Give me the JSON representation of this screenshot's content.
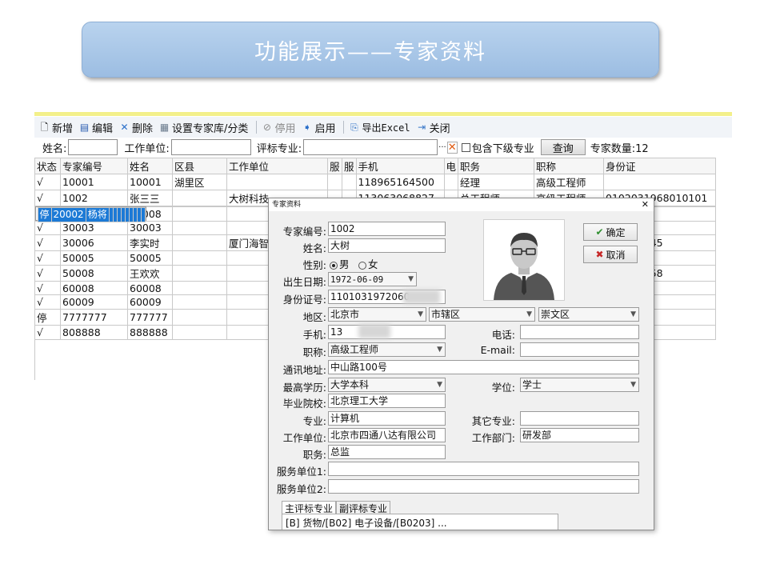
{
  "banner": {
    "title": "功能展示——专家资料"
  },
  "toolbar": {
    "new": "新增",
    "edit": "编辑",
    "delete": "删除",
    "settings": "设置专家库/分类",
    "disable": "停用",
    "enable": "启用",
    "export": "导出Excel",
    "close": "关闭"
  },
  "search": {
    "name_label": "姓名:",
    "org_label": "工作单位:",
    "major_label": "评标专业:",
    "include_sub": "包含下级专业",
    "query": "查询",
    "count": "专家数量:12"
  },
  "grid": {
    "headers": [
      "状态",
      "专家编号",
      "姓名",
      "区县",
      "工作单位",
      "服",
      "服",
      "手机",
      "电",
      "职务",
      "职称",
      "身份证"
    ],
    "rows": [
      [
        "√",
        "10001",
        "10001",
        "湖里区",
        "",
        "",
        "",
        "118965164500",
        "",
        "经理",
        "高级工程师",
        ""
      ],
      [
        "√",
        "1002",
        "张三三",
        "",
        "大树科技",
        "",
        "",
        "113063068827",
        "",
        "总工程师",
        "高级工程师",
        "0102031968010101"
      ],
      [
        "停",
        "20002",
        "杨将",
        "",
        "",
        "",
        "",
        "",
        "",
        "",
        "",
        ""
      ],
      [
        "√",
        "20008",
        "20008",
        "",
        "",
        "",
        "",
        "",
        "",
        "",
        "",
        ""
      ],
      [
        "√",
        "30003",
        "30003",
        "",
        "",
        "",
        "",
        "",
        "",
        "",
        "",
        ""
      ],
      [
        "√",
        "30006",
        "李实时",
        "",
        "厦门海智",
        "",
        "",
        "",
        "",
        "",
        "",
        "010102345"
      ],
      [
        "√",
        "50005",
        "50005",
        "",
        "",
        "",
        "",
        "",
        "",
        "",
        "",
        ""
      ],
      [
        "√",
        "50008",
        "王欢欢",
        "",
        "",
        "",
        "",
        "",
        "",
        "",
        "",
        "011091258"
      ],
      [
        "√",
        "60008",
        "60008",
        "",
        "",
        "",
        "",
        "",
        "",
        "",
        "",
        ""
      ],
      [
        "√",
        "60009",
        "60009",
        "",
        "",
        "",
        "",
        "",
        "",
        "",
        "",
        ""
      ],
      [
        "停",
        "7777777",
        "777777",
        "",
        "",
        "",
        "",
        "",
        "",
        "",
        "",
        ""
      ],
      [
        "√",
        "808888",
        "888888",
        "",
        "",
        "",
        "",
        "",
        "",
        "",
        "",
        ""
      ]
    ]
  },
  "dialog": {
    "title": "专家资料",
    "ok": "确定",
    "cancel": "取消",
    "id_label": "专家编号:",
    "id": "1002",
    "name_label": "姓名:",
    "name": "大树",
    "gender_label": "性别:",
    "male": "男",
    "female": "女",
    "birth_label": "出生日期:",
    "birth": "1972-06-09",
    "idcard_label": "身份证号:",
    "idcard": "1101031972060",
    "region_label": "地区:",
    "city": "北京市",
    "district": "市辖区",
    "county": "崇文区",
    "mobile_label": "手机:",
    "mobile": "13",
    "phone_label": "电话:",
    "title_label": "职称:",
    "title_val": "高级工程师",
    "email_label": "E-mail:",
    "address_label": "通讯地址:",
    "address": "中山路100号",
    "edu_label": "最高学历:",
    "edu": "大学本科",
    "degree_label": "学位:",
    "degree": "学士",
    "school_label": "毕业院校:",
    "school": "北京理工大学",
    "major_label": "专业:",
    "major": "计算机",
    "other_major_label": "其它专业:",
    "org_label": "工作单位:",
    "org": "北京市四通八达有限公司",
    "dept_label": "工作部门:",
    "dept": "研发部",
    "post_label": "职务:",
    "post": "总监",
    "unit1_label": "服务单位1:",
    "unit2_label": "服务单位2:",
    "tab_main": "主评标专业",
    "tab_sub": "副评标专业",
    "tab_content": "[B] 货物/[B02] 电子设备/[B0203] ..."
  },
  "colors": {
    "selected_row": "#1c7ad6",
    "banner": "#a8c8ea"
  }
}
